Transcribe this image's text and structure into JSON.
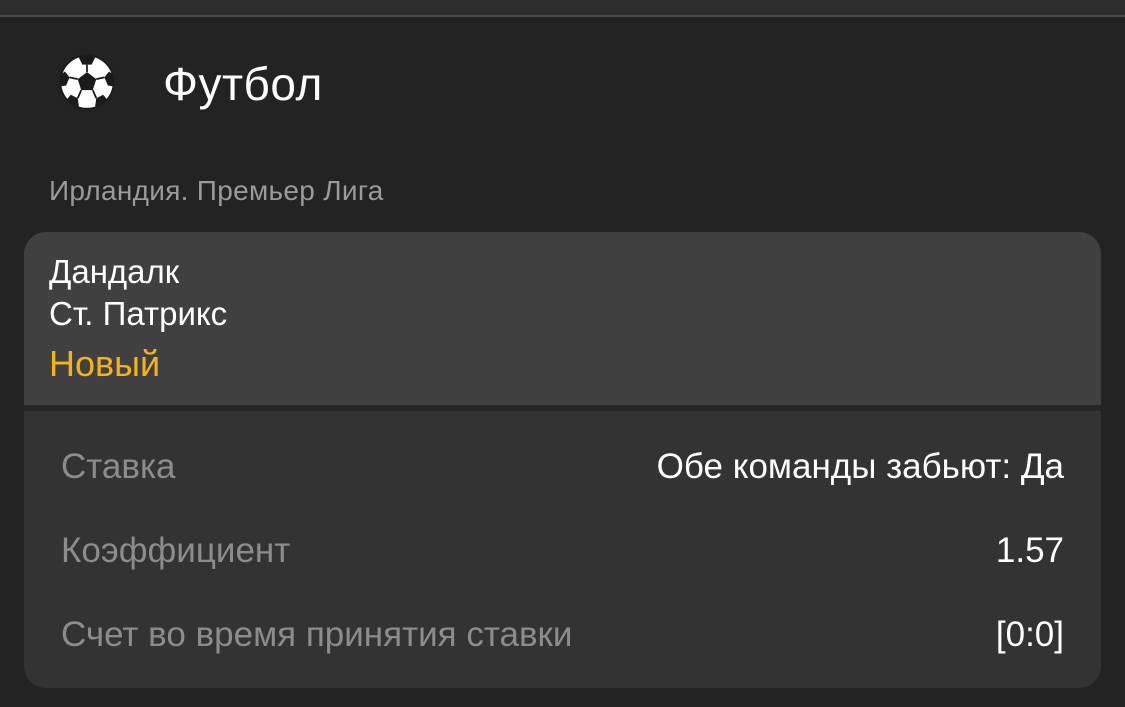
{
  "sport": {
    "icon": "soccer-ball-icon",
    "title": "Футбол"
  },
  "league": "Ирландия. Премьер Лига",
  "match": {
    "team_home": "Дандалк",
    "team_away": "Ст. Патрикс",
    "status": "Новый"
  },
  "details": [
    {
      "label": "Ставка",
      "value": "Обе команды забьют: Да"
    },
    {
      "label": "Коэффициент",
      "value": "1.57"
    },
    {
      "label": "Счет во время принятия ставки",
      "value": "[0:0]"
    }
  ],
  "colors": {
    "background": "#232323",
    "card_header": "#404040",
    "card_body": "#333333",
    "status_accent": "#f5b31a",
    "muted_text": "#8c8c8c"
  }
}
